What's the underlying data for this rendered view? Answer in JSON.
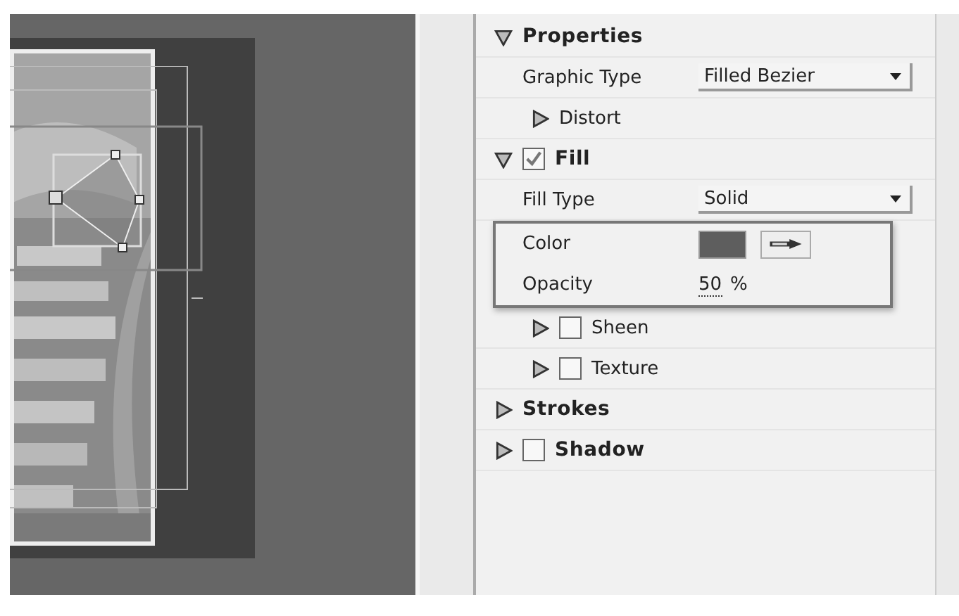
{
  "sections": [
    {
      "label": "Properties",
      "expanded": true,
      "children": [
        {
          "kind": "dropdown",
          "label": "Graphic Type",
          "value": "Filled Bezier",
          "highlighted": false
        },
        {
          "kind": "group",
          "label": "Distort",
          "expanded": false,
          "highlighted": false
        }
      ]
    },
    {
      "label": "Fill",
      "expanded": true,
      "checked": true,
      "children": [
        {
          "kind": "dropdown",
          "label": "Fill Type",
          "value": "Solid",
          "highlighted": false
        },
        {
          "kind": "color",
          "label": "Color",
          "color": "#5e5e5e",
          "highlighted": true
        },
        {
          "kind": "number",
          "label": "Opacity",
          "value": "50",
          "unit": "%",
          "highlighted": true
        },
        {
          "kind": "group",
          "label": "Sheen",
          "expanded": false,
          "checked": false,
          "highlighted": false
        },
        {
          "kind": "group",
          "label": "Texture",
          "expanded": false,
          "checked": false,
          "highlighted": false
        }
      ]
    },
    {
      "label": "Strokes",
      "expanded": false
    },
    {
      "label": "Shadow",
      "expanded": false,
      "checked": false
    }
  ]
}
